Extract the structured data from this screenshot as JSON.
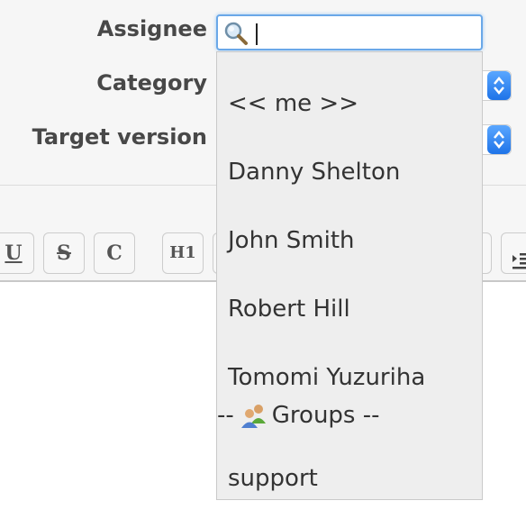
{
  "form": {
    "assignee_label": "Assignee",
    "category_label": "Category",
    "target_version_label": "Target version",
    "assignee_input_value": ""
  },
  "toolbar": {
    "underline_label": "U",
    "strike_label": "S",
    "code_label": "C",
    "h1_label": "H1"
  },
  "dropdown": {
    "items": [
      "<< me >>",
      "Danny Shelton",
      "John Smith",
      "Robert Hill",
      "Tomomi Yuzuriha"
    ],
    "group_header": "-- Groups --",
    "group_items": [
      "support"
    ]
  },
  "icons": {
    "search": "search-icon",
    "group": "group-icon",
    "select_arrows": "select-arrows-icon",
    "indent": "indent-icon"
  },
  "colors": {
    "focus_border": "#6aa8e8",
    "select_accent": "#1e73e8",
    "dropdown_bg": "#eeeeee"
  }
}
